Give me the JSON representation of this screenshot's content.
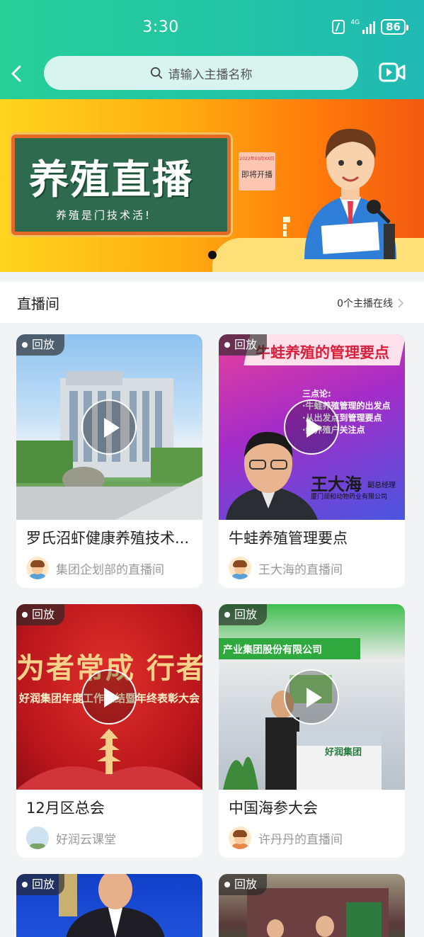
{
  "status_bar": {
    "time": "3:30",
    "network": "4G",
    "battery": "86"
  },
  "header": {
    "search_placeholder": "请输入主播名称"
  },
  "banner": {
    "title": "养殖直播",
    "subtitle": "养殖是门技术活!",
    "note_date": "2022年03月XX日",
    "note_text": "即将开播"
  },
  "section": {
    "title": "直播间",
    "online_text": "0个主播在线"
  },
  "cards": [
    {
      "tag": "回放",
      "title": "罗氏沼虾健康养殖技术...",
      "author": "集团企划部的直播间"
    },
    {
      "tag": "回放",
      "title": "牛蛙养殖管理要点",
      "author": "王大海的直播间",
      "thumb_headline": "牛蛙养殖的管理要点",
      "thumb_points": [
        "三点论:",
        "·牛蛙养殖管理的出发点",
        "·从出发点到管理要点",
        "·给养殖户关注点"
      ],
      "thumb_name": "王大海",
      "thumb_role": "副总经理",
      "thumb_company": "厦门润和动物药业有限公司"
    },
    {
      "tag": "回放",
      "title": "12月区总会",
      "author": "好润云课堂",
      "thumb_slogan": "为者常成 行者常至",
      "thumb_banner": "好润集团年度工作总结暨年终表彰大会"
    },
    {
      "tag": "回放",
      "title": "中国海参大会",
      "author": "许丹丹的直播间",
      "thumb_sign": "产业集团股份有限公司",
      "thumb_brand": "好润集团"
    },
    {
      "tag": "回放"
    },
    {
      "tag": "回放"
    }
  ],
  "colors": {
    "header_start": "#27cf97",
    "header_end": "#20b9b3",
    "search_bg": "#d8f4ee"
  }
}
